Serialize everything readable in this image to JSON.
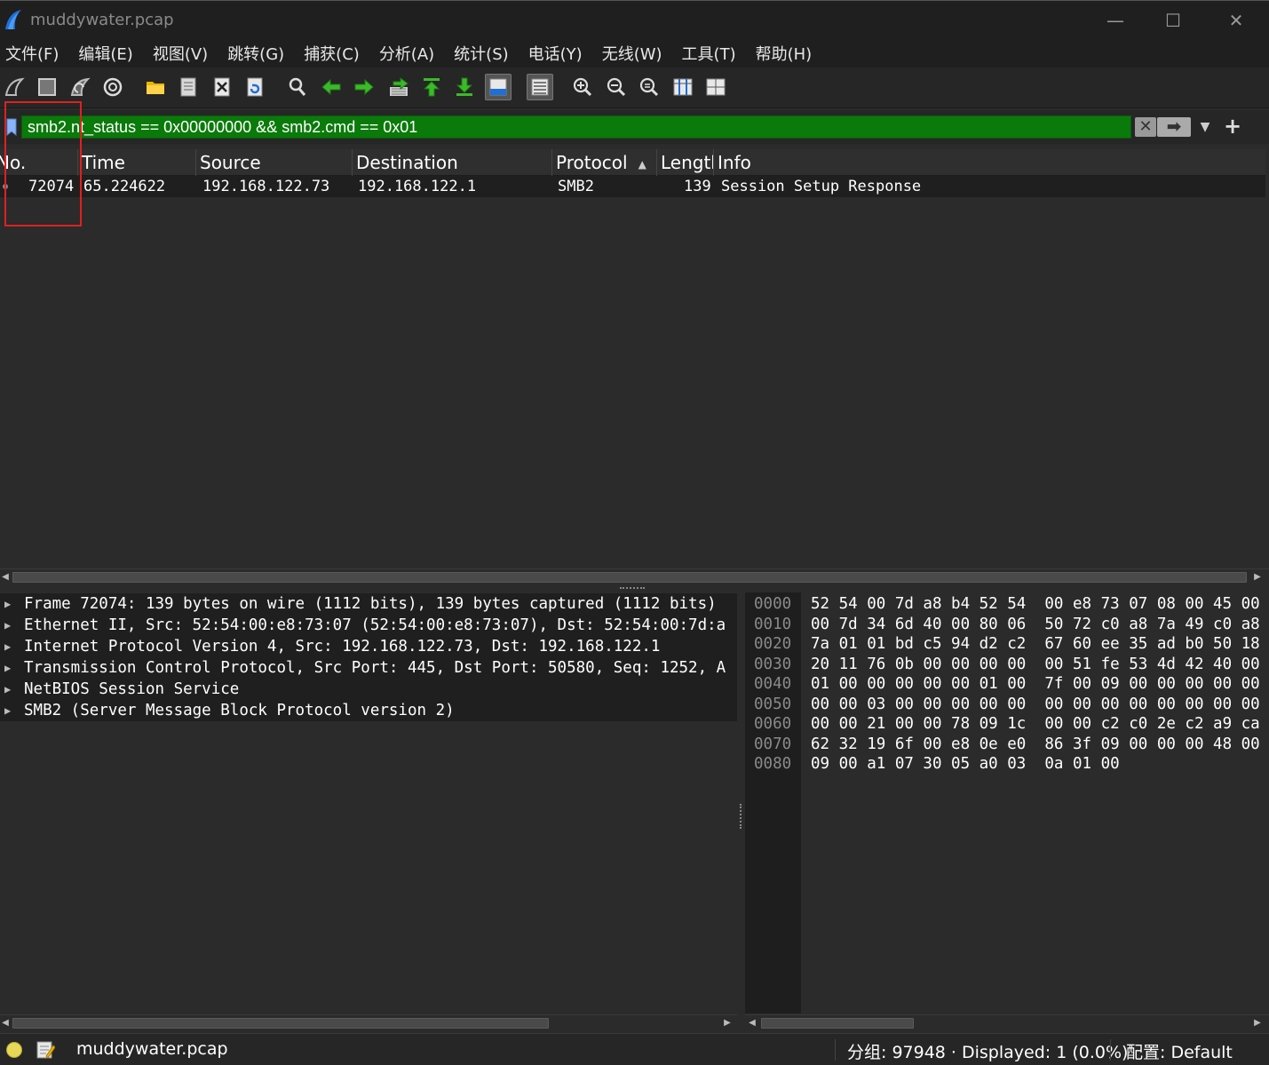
{
  "window": {
    "title": "muddywater.pcap",
    "min_glyph": "—",
    "max_glyph": "☐",
    "close_glyph": "✕"
  },
  "menu": [
    {
      "label": "文件(F)"
    },
    {
      "label": "编辑(E)"
    },
    {
      "label": "视图(V)"
    },
    {
      "label": "跳转(G)"
    },
    {
      "label": "捕获(C)"
    },
    {
      "label": "分析(A)"
    },
    {
      "label": "统计(S)"
    },
    {
      "label": "电话(Y)"
    },
    {
      "label": "无线(W)"
    },
    {
      "label": "工具(T)"
    },
    {
      "label": "帮助(H)"
    }
  ],
  "toolbar_icons": [
    "start-capture-icon",
    "stop-capture-icon",
    "restart-capture-icon",
    "capture-options-icon",
    "open-file-icon",
    "save-file-icon",
    "close-file-icon",
    "reload-file-icon",
    "find-packet-icon",
    "go-back-icon",
    "go-forward-icon",
    "go-to-packet-icon",
    "first-packet-icon",
    "last-packet-icon",
    "auto-scroll-icon",
    "colorize-icon",
    "zoom-in-icon",
    "zoom-out-icon",
    "zoom-normal-icon",
    "resize-columns-icon",
    "columns-layout-icon"
  ],
  "filter": {
    "expression": "smb2.nt_status == 0x00000000 && smb2.cmd == 0x01",
    "clear_glyph": "✕",
    "apply_glyph": "➡",
    "dropdown_glyph": "▼",
    "add_glyph": "+"
  },
  "packet_list": {
    "columns": [
      "No.",
      "Time",
      "Source",
      "Destination",
      "Protocol",
      "Length",
      "Info"
    ],
    "sort_arrow": "▲",
    "rows": [
      {
        "no": "72074",
        "time": "65.224622",
        "source": "192.168.122.73",
        "destination": "192.168.122.1",
        "protocol": "SMB2",
        "length": "139",
        "info": "Session Setup Response"
      }
    ]
  },
  "details": [
    "Frame 72074: 139 bytes on wire (1112 bits), 139 bytes captured (1112 bits)",
    "Ethernet II, Src: 52:54:00:e8:73:07 (52:54:00:e8:73:07), Dst: 52:54:00:7d:a",
    "Internet Protocol Version 4, Src: 192.168.122.73, Dst: 192.168.122.1",
    "Transmission Control Protocol, Src Port: 445, Dst Port: 50580, Seq: 1252, A",
    "NetBIOS Session Service",
    "SMB2 (Server Message Block Protocol version 2)"
  ],
  "expander_glyph": "▶",
  "bytes": [
    {
      "offset": "0000",
      "hex": "52 54 00 7d a8 b4 52 54  00 e8 73 07 08 00 45 00"
    },
    {
      "offset": "0010",
      "hex": "00 7d 34 6d 40 00 80 06  50 72 c0 a8 7a 49 c0 a8"
    },
    {
      "offset": "0020",
      "hex": "7a 01 01 bd c5 94 d2 c2  67 60 ee 35 ad b0 50 18"
    },
    {
      "offset": "0030",
      "hex": "20 11 76 0b 00 00 00 00  00 51 fe 53 4d 42 40 00"
    },
    {
      "offset": "0040",
      "hex": "01 00 00 00 00 00 01 00  7f 00 09 00 00 00 00 00"
    },
    {
      "offset": "0050",
      "hex": "00 00 03 00 00 00 00 00  00 00 00 00 00 00 00 00"
    },
    {
      "offset": "0060",
      "hex": "00 00 21 00 00 78 09 1c  00 00 c2 c0 2e c2 a9 ca"
    },
    {
      "offset": "0070",
      "hex": "62 32 19 6f 00 e8 0e e0  86 3f 09 00 00 00 48 00"
    },
    {
      "offset": "0080",
      "hex": "09 00 a1 07 30 05 a0 03  0a 01 00"
    }
  ],
  "scroll": {
    "left_glyph": "◀",
    "right_glyph": "▶"
  },
  "status": {
    "filename": "muddywater.pcap",
    "packets": "分组: 97948 · Displayed: 1 (0.0%)",
    "profile": "配置: Default"
  },
  "colors": {
    "filter_valid": "#0a7a0a",
    "highlight_box": "#e02020",
    "logo_blue": "#1e6fd8"
  }
}
